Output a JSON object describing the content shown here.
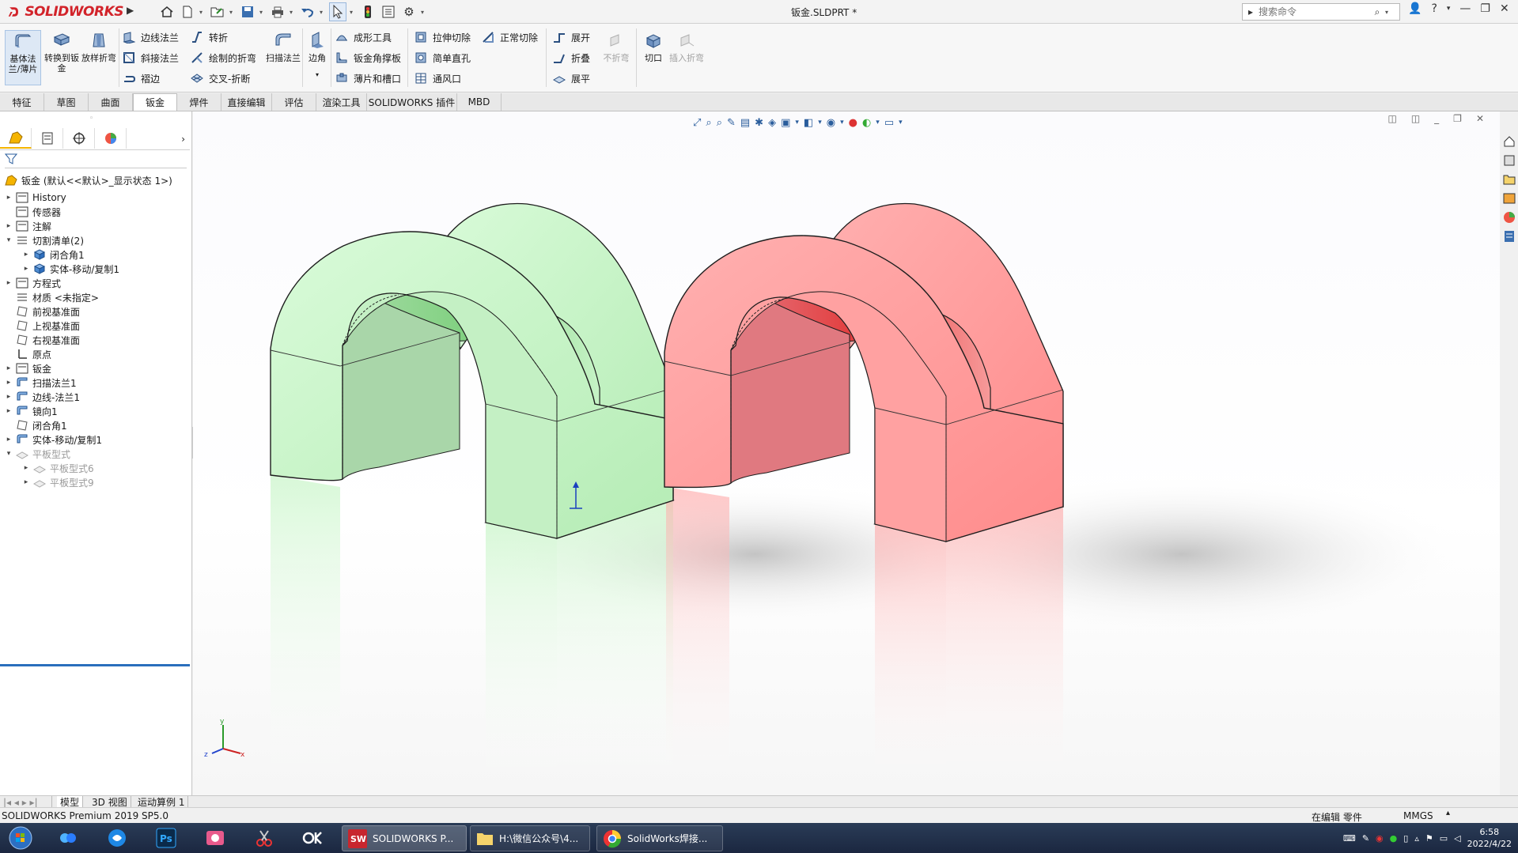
{
  "titlebar": {
    "brand": "SOLIDWORKS",
    "doc_title": "钣金.SLDPRT *",
    "search_placeholder": "搜索命令"
  },
  "ribbon": {
    "big_buttons": [
      {
        "id": "base-flange",
        "label": "基体法兰/薄片"
      },
      {
        "id": "convert-sheet",
        "label": "转换到钣金"
      },
      {
        "id": "lofted-bend",
        "label": "放样折弯"
      }
    ],
    "group1": [
      "边线法兰",
      "斜接法兰",
      "褶边"
    ],
    "group2": [
      "转折",
      "绘制的折弯",
      "交叉-折断"
    ],
    "sweep_flange": "扫描法兰",
    "corner": "边角",
    "group3": [
      "成形工具",
      "钣金角撑板",
      "薄片和槽口"
    ],
    "group4": [
      "拉伸切除",
      "简单直孔",
      "通风口"
    ],
    "normal_cut": "正常切除",
    "group5": [
      "展开",
      "折叠",
      "展平"
    ],
    "no_bends": "不折弯",
    "rip": "切口",
    "insert_bends": "插入折弯"
  },
  "tabs": [
    "特征",
    "草图",
    "曲面",
    "钣金",
    "焊件",
    "直接编辑",
    "评估",
    "渲染工具",
    "SOLIDWORKS 插件",
    "MBD"
  ],
  "active_tab": "钣金",
  "tree": {
    "root": "钣金  (默认<<默认>_显示状态 1>)",
    "items": [
      {
        "label": "History",
        "expandable": true,
        "indent": 0,
        "dim": false
      },
      {
        "label": "传感器",
        "expandable": false,
        "indent": 0,
        "dim": false
      },
      {
        "label": "注解",
        "expandable": true,
        "indent": 0,
        "dim": false
      },
      {
        "label": "切割清单(2)",
        "expandable": true,
        "expanded": true,
        "indent": 0,
        "dim": false
      },
      {
        "label": "闭合角1",
        "expandable": true,
        "indent": 1,
        "dim": false
      },
      {
        "label": "实体-移动/复制1",
        "expandable": true,
        "indent": 1,
        "dim": false
      },
      {
        "label": "方程式",
        "expandable": true,
        "indent": 0,
        "dim": false
      },
      {
        "label": "材质 <未指定>",
        "expandable": false,
        "indent": 0,
        "dim": false
      },
      {
        "label": "前视基准面",
        "expandable": false,
        "indent": 0,
        "dim": false
      },
      {
        "label": "上视基准面",
        "expandable": false,
        "indent": 0,
        "dim": false
      },
      {
        "label": "右视基准面",
        "expandable": false,
        "indent": 0,
        "dim": false
      },
      {
        "label": "原点",
        "expandable": false,
        "indent": 0,
        "dim": false
      },
      {
        "label": "钣金",
        "expandable": true,
        "indent": 0,
        "dim": false
      },
      {
        "label": "扫描法兰1",
        "expandable": true,
        "indent": 0,
        "dim": false
      },
      {
        "label": "边线-法兰1",
        "expandable": true,
        "indent": 0,
        "dim": false
      },
      {
        "label": "镜向1",
        "expandable": true,
        "indent": 0,
        "dim": false
      },
      {
        "label": "闭合角1",
        "expandable": false,
        "indent": 0,
        "dim": false
      },
      {
        "label": "实体-移动/复制1",
        "expandable": true,
        "indent": 0,
        "dim": false
      },
      {
        "label": "平板型式",
        "expandable": true,
        "expanded": true,
        "indent": 0,
        "dim": true
      },
      {
        "label": "平板型式6",
        "expandable": true,
        "indent": 1,
        "dim": true
      },
      {
        "label": "平板型式9",
        "expandable": true,
        "indent": 1,
        "dim": true
      }
    ]
  },
  "bottom_tabs": [
    "模型",
    "3D 视图",
    "运动算例 1"
  ],
  "status": {
    "product": "SOLIDWORKS Premium 2019 SP5.0",
    "mode": "在编辑 零件",
    "units": "MMGS"
  },
  "taskbar": {
    "apps": [
      "SOLIDWORKS P...",
      "H:\\微信公众号\\4...",
      "SolidWorks焊接..."
    ],
    "time": "6:58",
    "date": "2022/4/22"
  },
  "colors": {
    "green_body": "#c7f5c7",
    "red_body": "#ff9c9c",
    "brand_red": "#d2232a",
    "accent_blue": "#2a6fbc"
  }
}
